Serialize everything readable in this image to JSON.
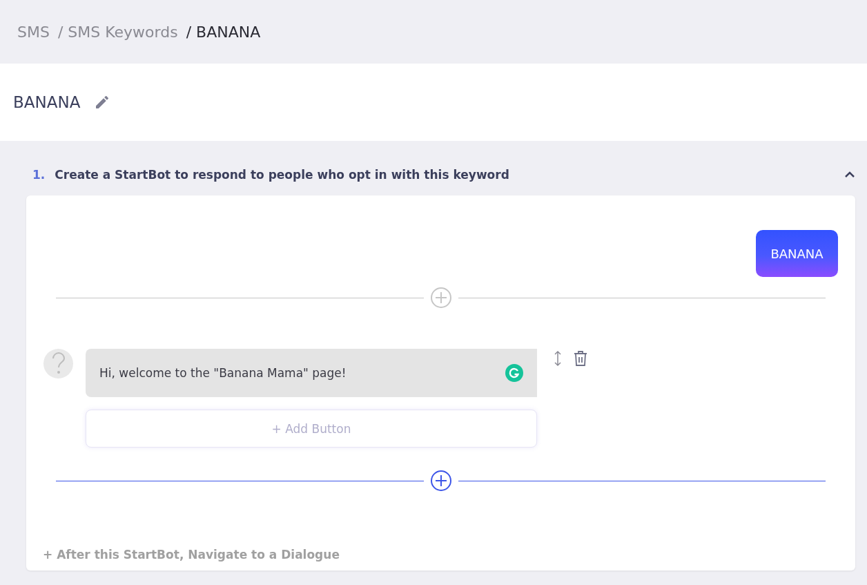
{
  "breadcrumbs": [
    {
      "label": "SMS",
      "current": false
    },
    {
      "label": "/ SMS Keywords",
      "current": false
    },
    {
      "label": "/ BANANA",
      "current": true
    }
  ],
  "title": "BANANA",
  "section": {
    "number": "1.",
    "title": "Create a StartBot to respond to people who opt in with this keyword",
    "expanded": true
  },
  "keyword_bubble": "BANANA",
  "dividers": [
    {
      "highlighted": false
    },
    {
      "highlighted": true
    }
  ],
  "message": {
    "text": "Hi, welcome to the \"Banana Mama\" page!",
    "add_button": "+ Add Button"
  },
  "navigate_link": "+ After this StartBot, Navigate to a Dialogue"
}
